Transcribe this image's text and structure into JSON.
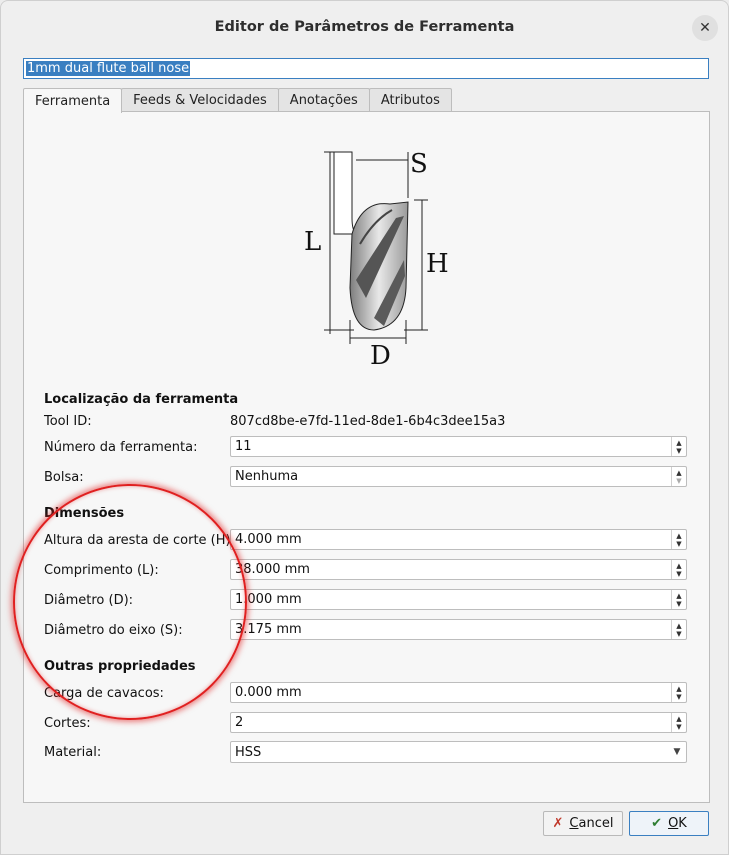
{
  "window": {
    "title": "Editor de Parâmetros de Ferramenta",
    "close_glyph": "✕"
  },
  "tool_name": "1mm dual flute ball nose",
  "tabs": [
    {
      "label": "Ferramenta",
      "active": true
    },
    {
      "label": "Feeds & Velocidades",
      "active": false
    },
    {
      "label": "Anotações",
      "active": false
    },
    {
      "label": "Atributos",
      "active": false
    }
  ],
  "diagram": {
    "label_s": "S",
    "label_l": "L",
    "label_h": "H",
    "label_d": "D"
  },
  "location": {
    "title": "Localização da ferramenta",
    "tool_id_label": "Tool ID:",
    "tool_id": "807cd8be-e7fd-11ed-8de1-6b4c3dee15a3",
    "number_label": "Número da ferramenta:",
    "number": "11",
    "pocket_label": "Bolsa:",
    "pocket": "Nenhuma"
  },
  "dimensions": {
    "title": "Dimensões",
    "h_label": "Altura da aresta de corte (H):",
    "h_value": "4.000 mm",
    "l_label": "Comprimento (L):",
    "l_value": "38.000 mm",
    "d_label": "Diâmetro (D):",
    "d_value": "1.000 mm",
    "s_label": "Diâmetro do eixo (S):",
    "s_value": "3.175 mm"
  },
  "other": {
    "title": "Outras propriedades",
    "chipload_label": "Carga de cavacos:",
    "chipload": "0.000 mm",
    "flutes_label": "Cortes:",
    "flutes": "2",
    "material_label": "Material:",
    "material": "HSS"
  },
  "buttons": {
    "cancel": "Cancel",
    "ok": "OK",
    "cancel_icon": "✗",
    "ok_icon": "✔"
  },
  "colors": {
    "accent": "#3a7fc1",
    "highlight_ring": "#e02020"
  }
}
